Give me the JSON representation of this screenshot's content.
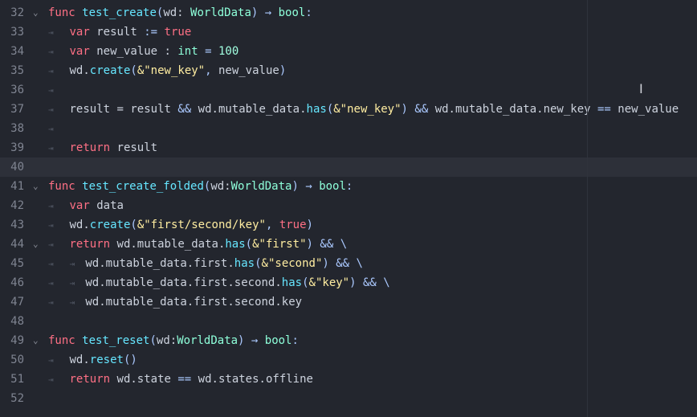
{
  "editor": {
    "lines": [
      {
        "n": "32",
        "fold": "⌄",
        "segs": [
          [
            "kw",
            "func "
          ],
          [
            "fn",
            "test_create"
          ],
          [
            "sym",
            "("
          ],
          [
            "id",
            "wd: "
          ],
          [
            "ty",
            "WorldData"
          ],
          [
            "sym",
            ") → "
          ],
          [
            "ty",
            "bool"
          ],
          [
            "sym",
            ":"
          ]
        ]
      },
      {
        "n": "33",
        "fold": "",
        "segs": [
          [
            "ind",
            "⇥   "
          ],
          [
            "kw",
            "var "
          ],
          [
            "id",
            "result "
          ],
          [
            "sym",
            ":= "
          ],
          [
            "boolv",
            "true"
          ]
        ]
      },
      {
        "n": "34",
        "fold": "",
        "segs": [
          [
            "ind",
            "⇥   "
          ],
          [
            "kw",
            "var "
          ],
          [
            "id",
            "new_value : "
          ],
          [
            "ty",
            "int"
          ],
          [
            "sym",
            " = "
          ],
          [
            "num-lit",
            "100"
          ]
        ]
      },
      {
        "n": "35",
        "fold": "",
        "segs": [
          [
            "ind",
            "⇥   "
          ],
          [
            "id",
            "wd."
          ],
          [
            "fn",
            "create"
          ],
          [
            "sym",
            "("
          ],
          [
            "str",
            "&\"new_key\""
          ],
          [
            "sym",
            ", "
          ],
          [
            "id",
            "new_value"
          ],
          [
            "sym",
            ")"
          ]
        ]
      },
      {
        "n": "36",
        "fold": "",
        "segs": [
          [
            "ind",
            "⇥"
          ]
        ]
      },
      {
        "n": "37",
        "fold": "",
        "segs": [
          [
            "ind",
            "⇥   "
          ],
          [
            "id",
            "result = result "
          ],
          [
            "sym",
            "&& "
          ],
          [
            "id",
            "wd.mutable_data."
          ],
          [
            "fn",
            "has"
          ],
          [
            "sym",
            "("
          ],
          [
            "str",
            "&\"new_key\""
          ],
          [
            "sym",
            ") && "
          ],
          [
            "id",
            "wd.mutable_data.new_key "
          ],
          [
            "sym",
            "== "
          ],
          [
            "id",
            "new_value"
          ]
        ]
      },
      {
        "n": "38",
        "fold": "",
        "segs": [
          [
            "ind",
            "⇥"
          ]
        ]
      },
      {
        "n": "39",
        "fold": "",
        "segs": [
          [
            "ind",
            "⇥   "
          ],
          [
            "kw",
            "return "
          ],
          [
            "id",
            "result"
          ]
        ]
      },
      {
        "n": "40",
        "fold": "",
        "current": true,
        "segs": []
      },
      {
        "n": "41",
        "fold": "⌄",
        "segs": [
          [
            "kw",
            "func "
          ],
          [
            "fn",
            "test_create_folded"
          ],
          [
            "sym",
            "("
          ],
          [
            "id",
            "wd:"
          ],
          [
            "ty",
            "WorldData"
          ],
          [
            "sym",
            ") → "
          ],
          [
            "ty",
            "bool"
          ],
          [
            "sym",
            ":"
          ]
        ]
      },
      {
        "n": "42",
        "fold": "",
        "segs": [
          [
            "ind",
            "⇥   "
          ],
          [
            "kw",
            "var "
          ],
          [
            "id",
            "data"
          ]
        ]
      },
      {
        "n": "43",
        "fold": "",
        "segs": [
          [
            "ind",
            "⇥   "
          ],
          [
            "id",
            "wd."
          ],
          [
            "fn",
            "create"
          ],
          [
            "sym",
            "("
          ],
          [
            "str",
            "&\"first/second/key\""
          ],
          [
            "sym",
            ", "
          ],
          [
            "boolv",
            "true"
          ],
          [
            "sym",
            ")"
          ]
        ]
      },
      {
        "n": "44",
        "fold": "⌄",
        "segs": [
          [
            "ind",
            "⇥   "
          ],
          [
            "kw",
            "return "
          ],
          [
            "id",
            "wd.mutable_data."
          ],
          [
            "fn",
            "has"
          ],
          [
            "sym",
            "("
          ],
          [
            "str",
            "&\"first\""
          ],
          [
            "sym",
            ") && \\"
          ]
        ]
      },
      {
        "n": "45",
        "fold": "",
        "segs": [
          [
            "ind",
            "⇥   ⇥  "
          ],
          [
            "id",
            "wd.mutable_data.first."
          ],
          [
            "fn",
            "has"
          ],
          [
            "sym",
            "("
          ],
          [
            "str",
            "&\"second\""
          ],
          [
            "sym",
            ") && \\"
          ]
        ]
      },
      {
        "n": "46",
        "fold": "",
        "segs": [
          [
            "ind",
            "⇥   ⇥  "
          ],
          [
            "id",
            "wd.mutable_data.first.second."
          ],
          [
            "fn",
            "has"
          ],
          [
            "sym",
            "("
          ],
          [
            "str",
            "&\"key\""
          ],
          [
            "sym",
            ") && \\"
          ]
        ]
      },
      {
        "n": "47",
        "fold": "",
        "segs": [
          [
            "ind",
            "⇥   ⇥  "
          ],
          [
            "id",
            "wd.mutable_data.first.second.key"
          ]
        ]
      },
      {
        "n": "48",
        "fold": "",
        "segs": []
      },
      {
        "n": "49",
        "fold": "⌄",
        "segs": [
          [
            "kw",
            "func "
          ],
          [
            "fn",
            "test_reset"
          ],
          [
            "sym",
            "("
          ],
          [
            "id",
            "wd:"
          ],
          [
            "ty",
            "WorldData"
          ],
          [
            "sym",
            ") → "
          ],
          [
            "ty",
            "bool"
          ],
          [
            "sym",
            ":"
          ]
        ]
      },
      {
        "n": "50",
        "fold": "",
        "segs": [
          [
            "ind",
            "⇥   "
          ],
          [
            "id",
            "wd."
          ],
          [
            "fn",
            "reset"
          ],
          [
            "sym",
            "()"
          ]
        ]
      },
      {
        "n": "51",
        "fold": "",
        "segs": [
          [
            "ind",
            "⇥   "
          ],
          [
            "kw",
            "return "
          ],
          [
            "id",
            "wd.state "
          ],
          [
            "sym",
            "== "
          ],
          [
            "id",
            "wd.states.offline"
          ]
        ]
      },
      {
        "n": "52",
        "fold": "",
        "segs": []
      }
    ],
    "mouse_cursor_icon": "text-cursor-icon"
  }
}
